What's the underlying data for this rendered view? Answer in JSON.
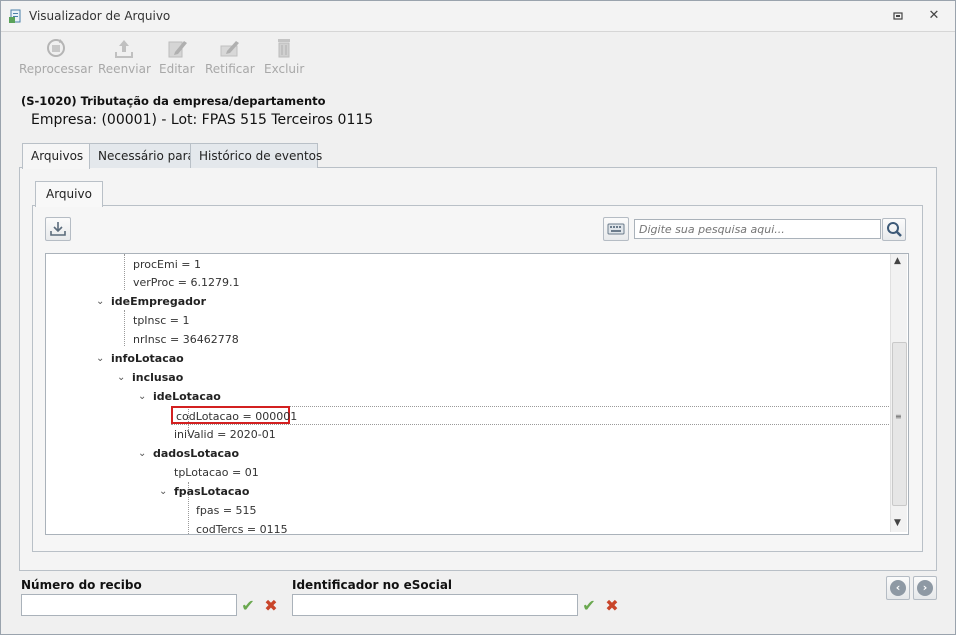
{
  "window": {
    "title": "Visualizador de Arquivo"
  },
  "toolbar": {
    "reprocessar": "Reprocessar",
    "reenviar": "Reenviar",
    "editar": "Editar",
    "retificar": "Retificar",
    "excluir": "Excluir"
  },
  "header": {
    "title": "(S-1020) Tributação da empresa/departamento",
    "subtitle": "Empresa: (00001) - Lot: FPAS 515 Terceiros 0115"
  },
  "tabs": [
    "Arquivos",
    "Necessário para",
    "Histórico de eventos"
  ],
  "inner_tab": "Arquivo",
  "search": {
    "placeholder": "Digite sua pesquisa aqui..."
  },
  "tree": [
    "procEmi = 1",
    "verProc = 6.1279.1",
    "ideEmpregador",
    "tpInsc = 1",
    "nrInsc = 36462778",
    "infoLotacao",
    "inclusao",
    "ideLotacao",
    "codLotacao = 000001",
    "iniValid = 2020-01",
    "dadosLotacao",
    "tpLotacao = 01",
    "fpasLotacao",
    "fpas = 515",
    "codTercs = 0115"
  ],
  "footer": {
    "recibo_label": "Número do recibo",
    "identificador_label": "Identificador no eSocial"
  },
  "colors": {
    "highlight": "#d32020",
    "confirm": "#6aa84f",
    "cancel": "#c9452a"
  }
}
